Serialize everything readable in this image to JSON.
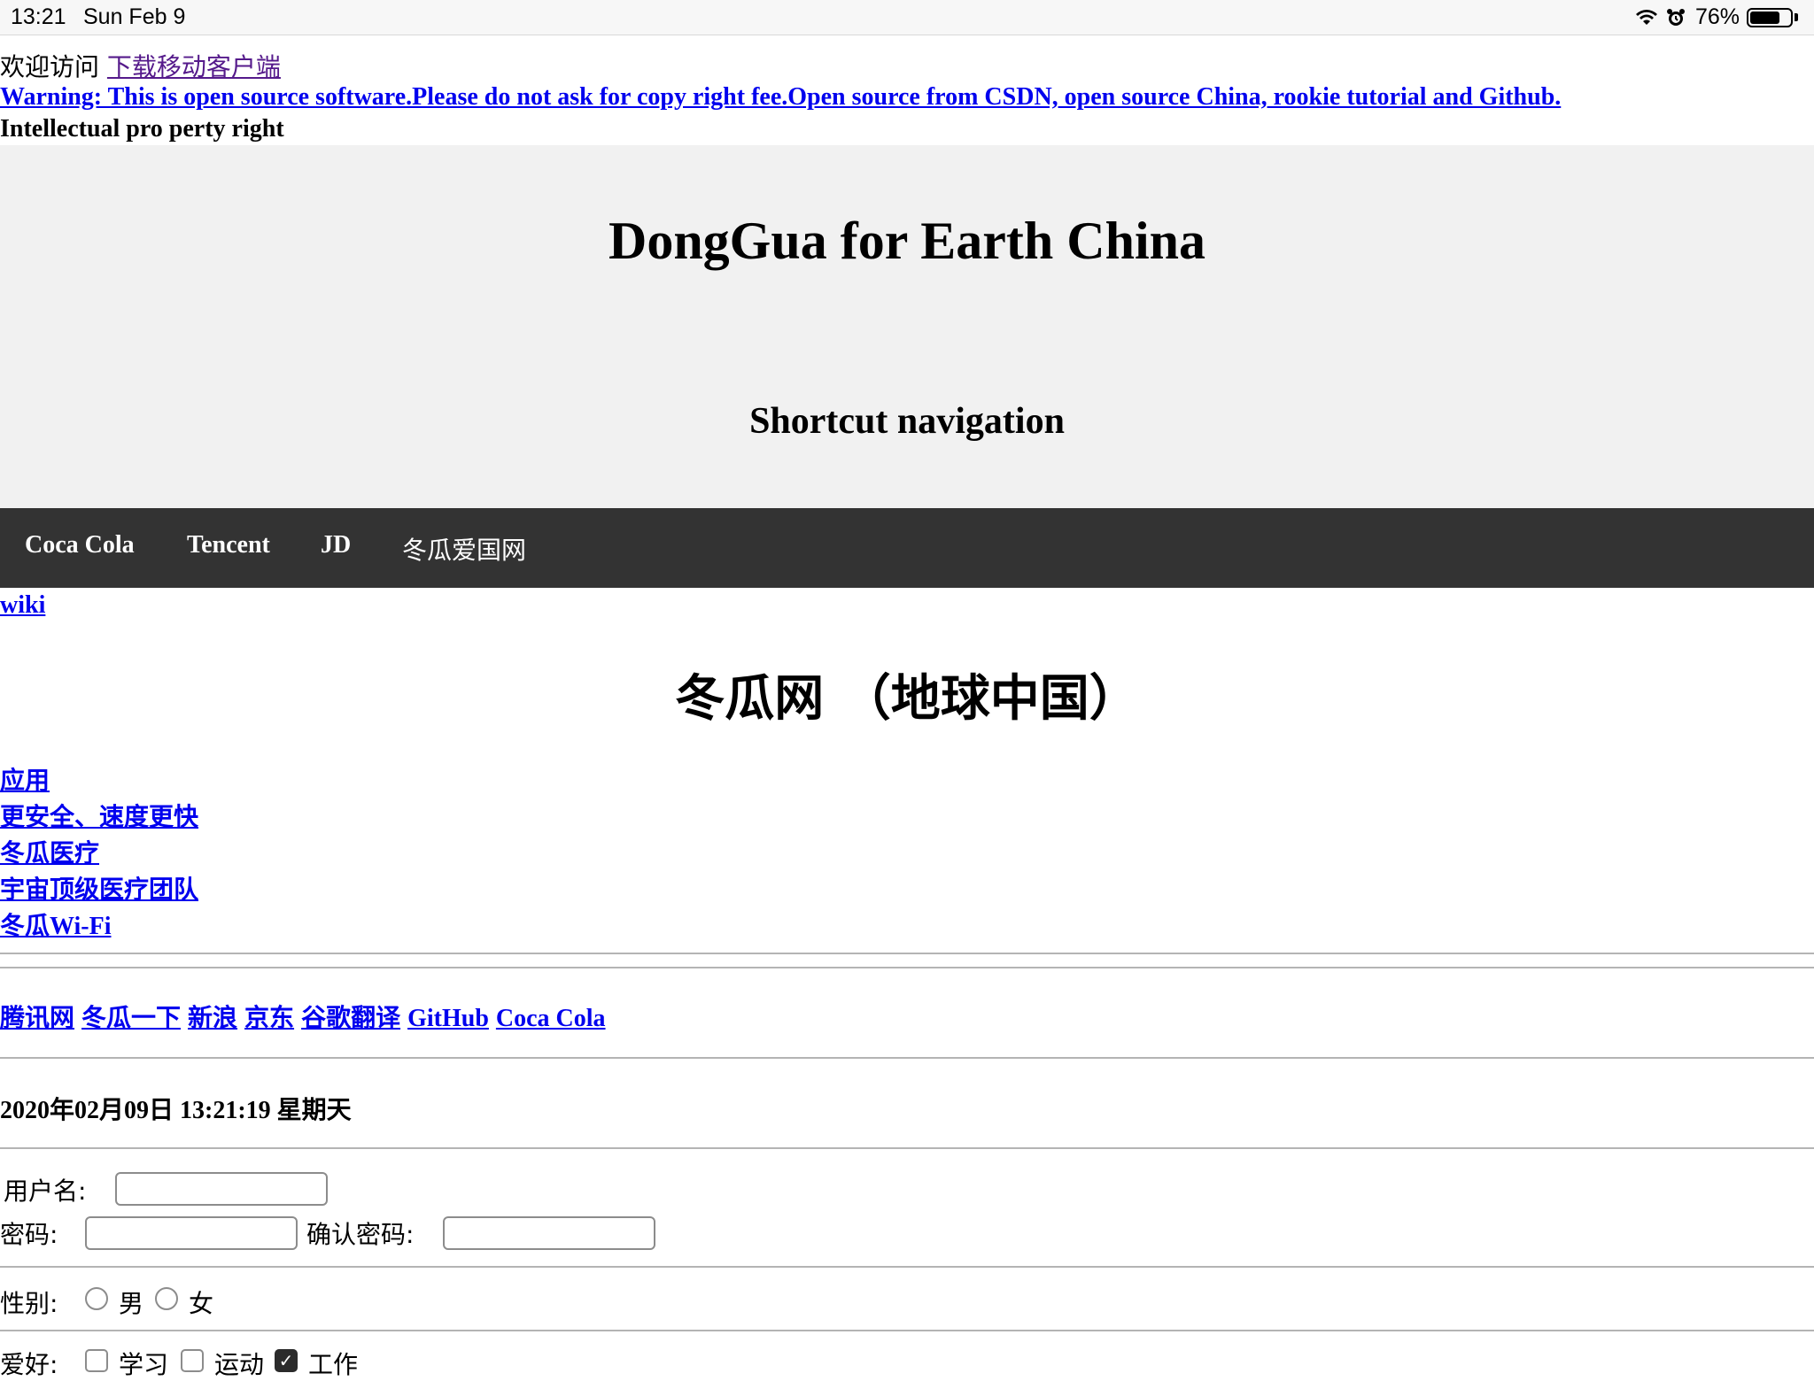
{
  "status_bar": {
    "time": "13:21",
    "date": "Sun Feb 9",
    "battery": "76%",
    "battery_level": 0.76
  },
  "top": {
    "welcome": "欢迎访问",
    "download_link": "下载移动客户端",
    "warning_link": "Warning: This is open source software.Please do not ask for copy right fee.Open source from CSDN, open source China, rookie tutorial and Github.",
    "ip_text": "Intellectual pro perty right"
  },
  "banner": {
    "title": "DongGua for Earth China",
    "subtitle": "Shortcut navigation"
  },
  "navbar": {
    "items": [
      "Coca Cola",
      "Tencent",
      "JD",
      "冬瓜爱国网"
    ]
  },
  "wiki_link": "wiki",
  "main_title": "冬瓜网 （地球中国）",
  "side_links": [
    "应用",
    "更安全、速度更快",
    "冬瓜医疗 ",
    "宇宙顶级医疗团队",
    "冬瓜Wi-Fi"
  ],
  "quick_links": [
    "腾讯网",
    "冬瓜一下",
    "新浪",
    "京东",
    "谷歌翻译",
    "GitHub",
    "Coca Cola"
  ],
  "datetime": "2020年02月09日 13:21:19 星期天",
  "form": {
    "username_label": "用户名:",
    "password_label": "密码:",
    "confirm_label": "确认密码:",
    "gender_label": "性别:",
    "male": "男",
    "female": "女",
    "hobby_label": "爱好:",
    "hobby_study": "学习",
    "hobby_sport": "运动",
    "hobby_work": "工作",
    "check_mark": "✓"
  }
}
